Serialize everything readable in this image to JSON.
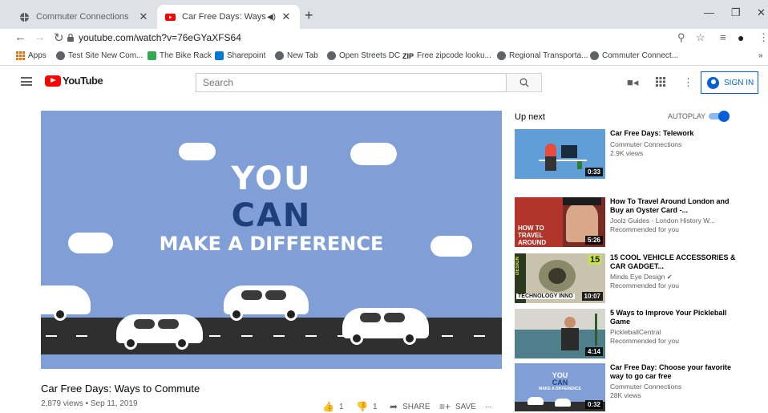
{
  "browser": {
    "tabs": [
      {
        "label": "Commuter Connections",
        "active": false
      },
      {
        "label": "Car Free Days: Ways to Comm",
        "active": true
      }
    ],
    "url": "youtube.com/watch?v=76eGYaXFS64",
    "bookmarks": [
      "Apps",
      "Test Site New Com...",
      "The Bike Rack",
      "Sharepoint",
      "New Tab",
      "Open Streets DC",
      "Free zipcode looku...",
      "Regional Transporta...",
      "Commuter Connect..."
    ],
    "bookmark_badge": "ZIP"
  },
  "youtube": {
    "logo_text": "YouTube",
    "search_placeholder": "Search",
    "signin_label": "SIGN IN"
  },
  "player": {
    "line1": "YOU",
    "line2": "CAN",
    "line3": "MAKE A DIFFERENCE",
    "colors": {
      "sky": "#7f9fd6",
      "accent_text": "#1f3f7a",
      "road": "#2f2f2f"
    }
  },
  "video": {
    "title": "Car Free Days: Ways to Commute",
    "meta": "2,879 views • Sep 11, 2019",
    "likes": "1",
    "dislikes": "1",
    "share": "SHARE",
    "save": "SAVE",
    "more": "..."
  },
  "sidebar": {
    "up_next": "Up next",
    "autoplay": "AUTOPLAY",
    "autoplay_on": true,
    "items": [
      {
        "title": "Car Free Days: Telework",
        "channel": "Commuter Connections",
        "sub": "2.9K views",
        "duration": "0:33"
      },
      {
        "title": "How To Travel Around London and Buy an Oyster Card -...",
        "channel": "Joolz Guides - London History W...",
        "sub": "Recommended for you",
        "duration": "5:26"
      },
      {
        "title": "15 COOL VEHICLE ACCESSORIES & CAR GADGET...",
        "channel": "Minds Eye Design",
        "sub": "Recommended for you",
        "duration": "10:07"
      },
      {
        "title": "5 Ways to Improve Your Pickleball Game",
        "channel": "PickleballCentral",
        "sub": "Recommended for you",
        "duration": "4:14"
      },
      {
        "title": "Car Free Day: Choose your favorite way to go car free",
        "channel": "Commuter Connections",
        "sub": "28K views",
        "duration": "0:32"
      }
    ]
  },
  "thumb_text": {
    "london": "HOW TO TRAVEL AROUND LONDON",
    "gadget_num": "15",
    "gadget_label": "TECHNOLOGY INNO",
    "gadget_side": "DESIGN",
    "cf_you": "YOU",
    "cf_can": "CAN",
    "cf_make": "MAKE A DIFFERENCE"
  }
}
